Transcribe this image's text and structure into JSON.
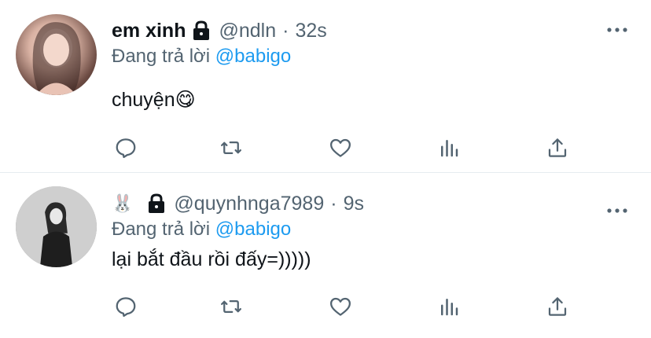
{
  "tweets": [
    {
      "display_name": "em xinh",
      "handle": "@ndln",
      "separator": "·",
      "time": "32s",
      "reply_prefix": "Đang trả lời",
      "reply_to": "@babigo",
      "text": "chuyện😋",
      "protected": true
    },
    {
      "display_name": "🐰",
      "handle": "@quynhnga7989",
      "separator": "·",
      "time": "9s",
      "reply_prefix": "Đang trả lời",
      "reply_to": "@babigo",
      "text": "lại bắt đầu rồi đấy=)))))",
      "protected": true
    }
  ],
  "icons": {
    "reply": "reply-icon",
    "retweet": "retweet-icon",
    "like": "heart-icon",
    "analytics": "analytics-icon",
    "share": "share-icon",
    "more": "more-icon",
    "lock": "lock-icon"
  },
  "colors": {
    "text": "#0f1419",
    "secondary": "#536471",
    "accent": "#1d9bf0",
    "divider": "#e6ecf0"
  }
}
